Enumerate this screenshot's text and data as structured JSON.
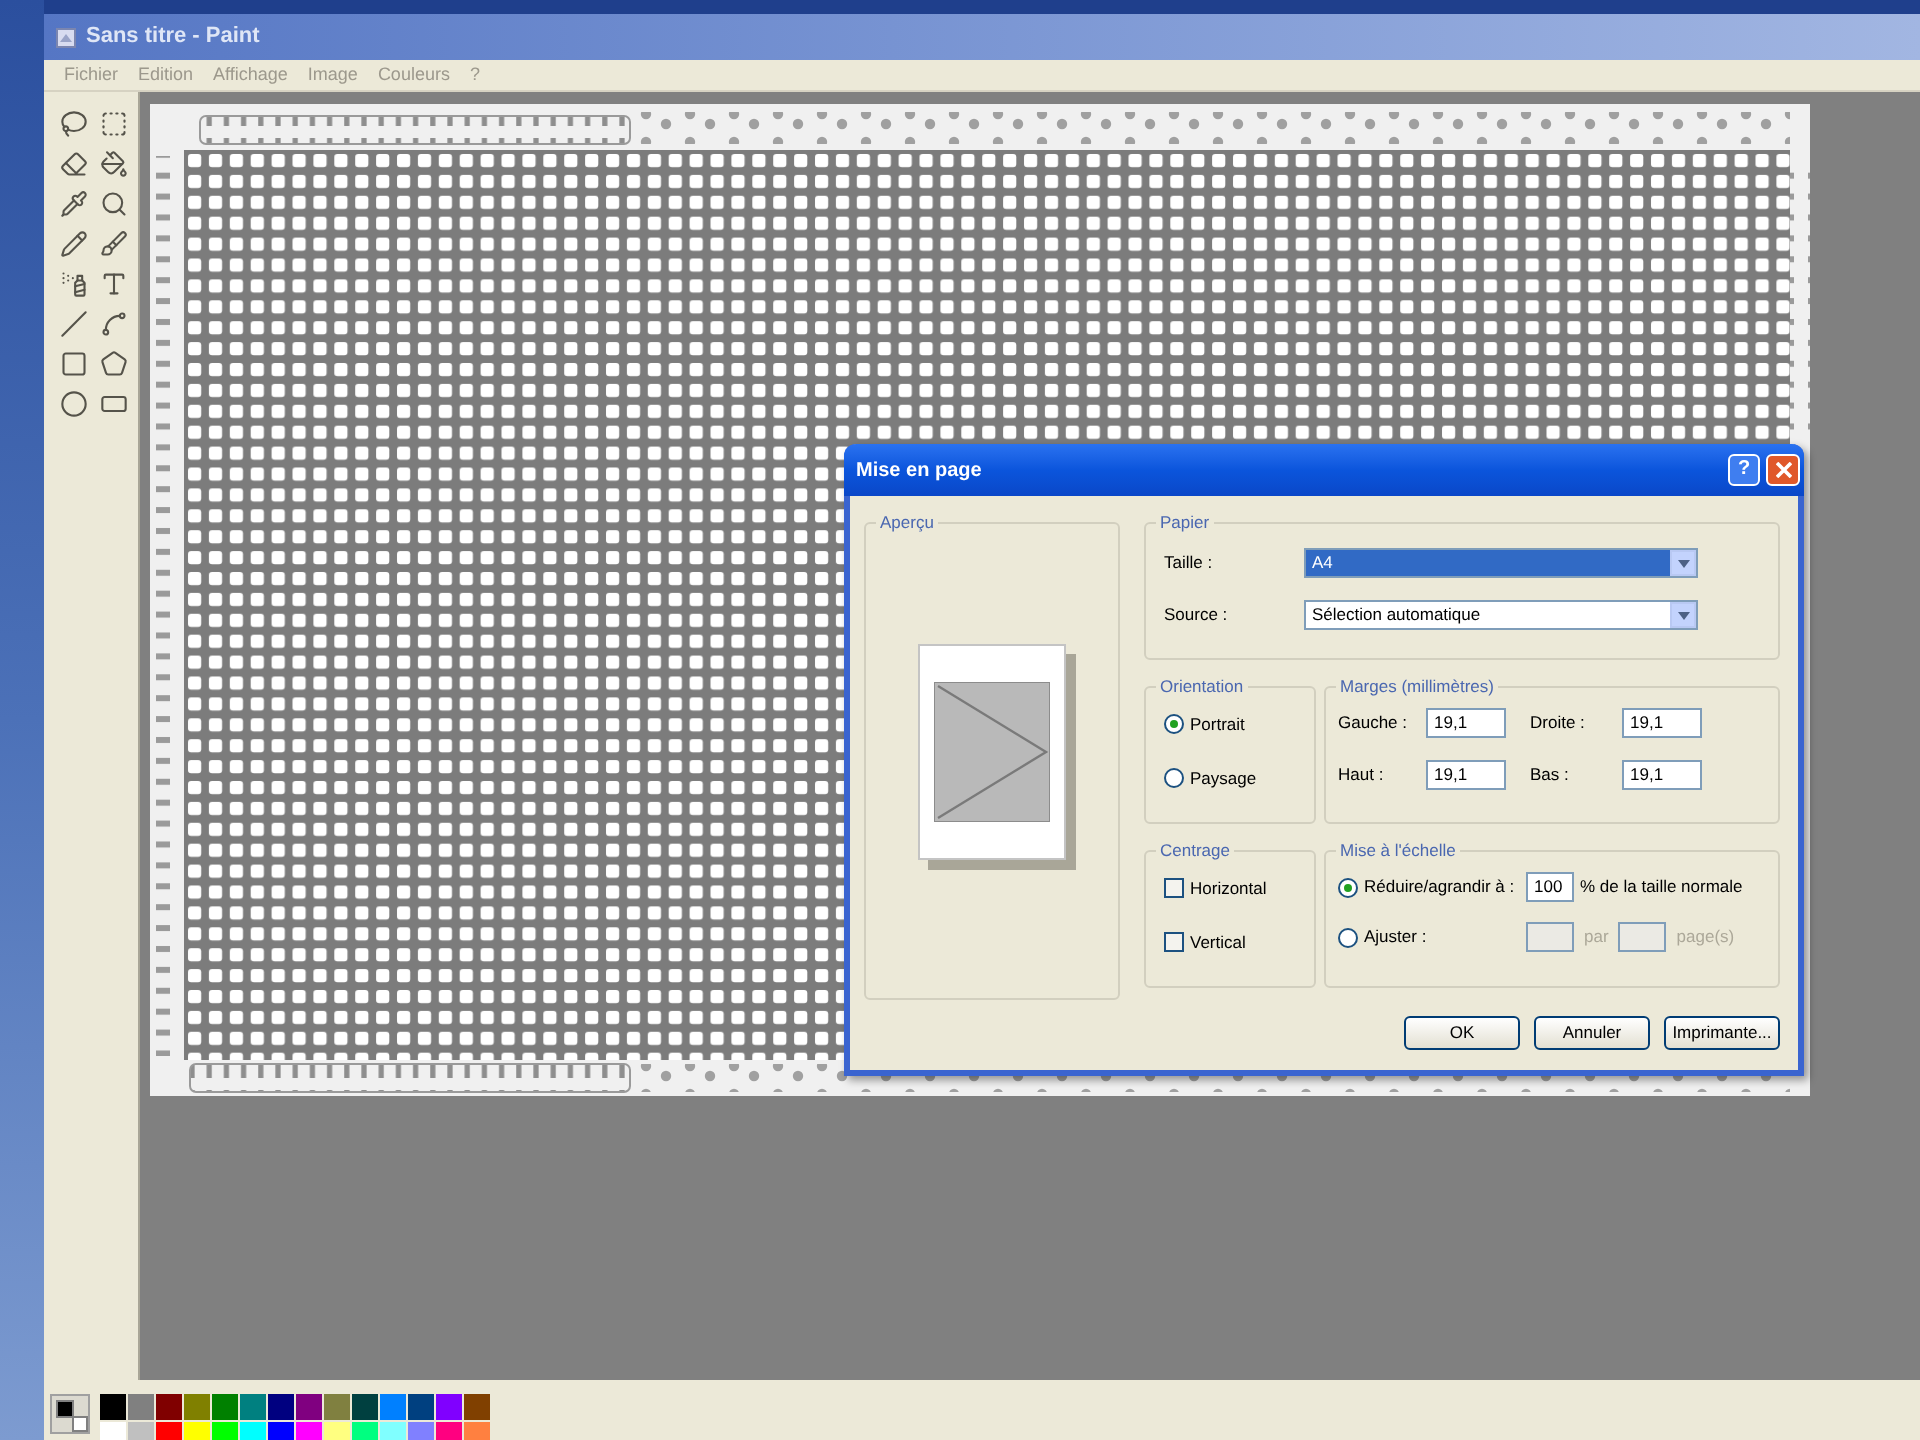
{
  "window": {
    "title": "Sans titre - Paint"
  },
  "menu": [
    "Fichier",
    "Edition",
    "Affichage",
    "Image",
    "Couleurs",
    "?"
  ],
  "toolbox": [
    {
      "kind": "free-select"
    },
    {
      "kind": "rect-select"
    },
    {
      "kind": "eraser"
    },
    {
      "kind": "fill"
    },
    {
      "kind": "picker"
    },
    {
      "kind": "zoom"
    },
    {
      "kind": "pencil"
    },
    {
      "kind": "brush"
    },
    {
      "kind": "airbrush"
    },
    {
      "kind": "text"
    },
    {
      "kind": "line"
    },
    {
      "kind": "curve"
    },
    {
      "kind": "rectangle"
    },
    {
      "kind": "polygon"
    },
    {
      "kind": "ellipse"
    },
    {
      "kind": "rounded-rectangle"
    }
  ],
  "dialog": {
    "title": "Mise en page",
    "help_button": "?",
    "preview": {
      "label": "Aperçu"
    },
    "paper": {
      "label": "Papier",
      "size": {
        "label": "Taille :",
        "value": "A4",
        "focused": true
      },
      "source": {
        "label": "Source :",
        "value": "Sélection automatique",
        "focused": false
      }
    },
    "orientation": {
      "label": "Orientation",
      "options": [
        {
          "label": "Portrait",
          "selected": true
        },
        {
          "label": "Paysage",
          "selected": false
        }
      ]
    },
    "margins": {
      "label": "Marges (millimètres)",
      "fields": [
        {
          "label": "Gauche :",
          "value": "19,1"
        },
        {
          "label": "Droite :",
          "value": "19,1"
        },
        {
          "label": "Haut :",
          "value": "19,1"
        },
        {
          "label": "Bas :",
          "value": "19,1"
        }
      ]
    },
    "centering": {
      "label": "Centrage",
      "options": [
        {
          "label": "Horizontal",
          "checked": false
        },
        {
          "label": "Vertical",
          "checked": false
        }
      ]
    },
    "scaling": {
      "label": "Mise à l'échelle",
      "adjust": {
        "label": "Réduire/agrandir à :",
        "selected": true,
        "value": "100",
        "suffix": "% de la taille normale"
      },
      "fit": {
        "label": "Ajuster :",
        "selected": false,
        "disabled": true,
        "separator": "par",
        "suffix": "page(s)"
      }
    },
    "buttons": [
      "OK",
      "Annuler",
      "Imprimante..."
    ]
  },
  "palette": {
    "current": [
      {
        "kind": "foreground",
        "color": "#000000"
      },
      {
        "kind": "background",
        "color": "#ffffff"
      }
    ],
    "colors": [
      {
        "color": "#000000"
      },
      {
        "color": "#808080"
      },
      {
        "color": "#800000"
      },
      {
        "color": "#808000"
      },
      {
        "color": "#008000"
      },
      {
        "color": "#008080"
      },
      {
        "color": "#000080"
      },
      {
        "color": "#800080"
      },
      {
        "color": "#808040"
      },
      {
        "color": "#004040"
      },
      {
        "color": "#0080ff"
      },
      {
        "color": "#004080"
      },
      {
        "color": "#8000ff"
      },
      {
        "color": "#804000"
      },
      {
        "color": "#ffffff"
      },
      {
        "color": "#c0c0c0"
      },
      {
        "color": "#ff0000"
      },
      {
        "color": "#ffff00"
      },
      {
        "color": "#00ff00"
      },
      {
        "color": "#00ffff"
      },
      {
        "color": "#0000ff"
      },
      {
        "color": "#ff00ff"
      },
      {
        "color": "#ffff80"
      },
      {
        "color": "#00ff80"
      },
      {
        "color": "#80ffff"
      },
      {
        "color": "#8080ff"
      },
      {
        "color": "#ff0080"
      },
      {
        "color": "#ff8040"
      }
    ]
  }
}
